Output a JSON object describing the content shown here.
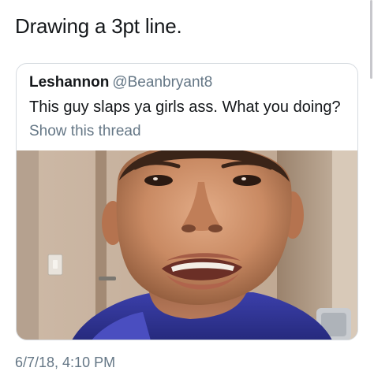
{
  "tweet": {
    "text": "Drawing a 3pt line.",
    "timestamp": "6/7/18, 4:10 PM"
  },
  "quoted_tweet": {
    "display_name": "Leshannon",
    "handle": "@Beanbryant8",
    "text": "This guy slaps ya girls ass. What you doing?",
    "show_thread_label": "Show this thread",
    "media_icon": "selfie-photo"
  },
  "colors": {
    "primary_text": "#14171a",
    "secondary_text": "#657786",
    "card_border": "#d6dbe0"
  }
}
